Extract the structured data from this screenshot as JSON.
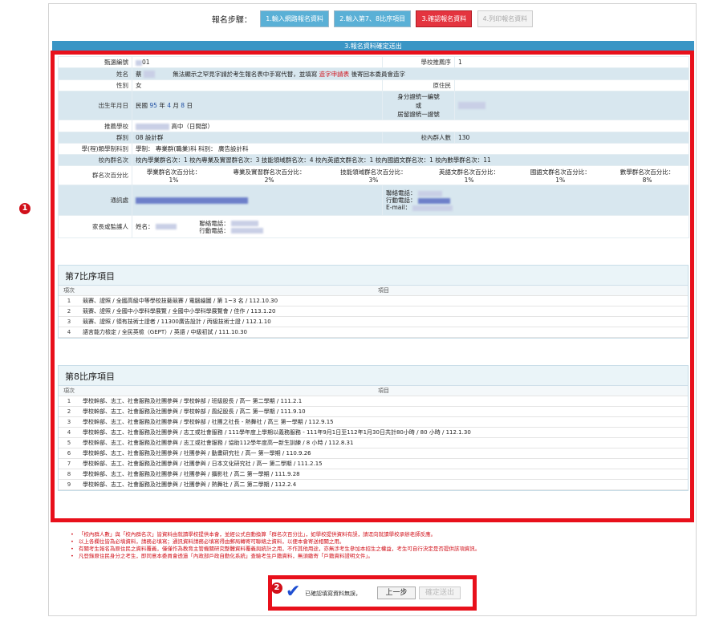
{
  "steps": {
    "label": "報名步驟：",
    "items": [
      {
        "label": "1.輸入網路報名資料",
        "state": "done"
      },
      {
        "label": "2.輸入第7、8比序項目",
        "state": "done"
      },
      {
        "label": "3.確認報名資料",
        "state": "active"
      },
      {
        "label": "4.列印報名資料",
        "state": "todo"
      }
    ]
  },
  "section_title": "3.報名資料確定送出",
  "badges": {
    "one": "1",
    "two": "2"
  },
  "info": {
    "exam_no_label": "甄選編號",
    "exam_no_value": "01",
    "school_order_label": "學校推薦序",
    "school_order_value": "1",
    "name_label": "姓名",
    "name_value": "蔡",
    "name_note_pre": "無法顯示之罕見字請於考生報名表中手寫代替，並填寫",
    "name_note_link": "造字申請表",
    "name_note_post": "後寄回本委員會造字",
    "gender_label": "性別",
    "gender_value": "女",
    "origin_label": "原住民",
    "origin_value": "",
    "birth_label": "出生年月日",
    "birth_pre": "民國",
    "birth_year": "95",
    "birth_year_unit": "年",
    "birth_month": "4",
    "birth_month_unit": "月",
    "birth_day": "8",
    "birth_day_unit": "日",
    "id_label_1": "身分證統一編號",
    "id_label_2": "或",
    "id_label_3": "居留證統一證號",
    "school_label": "推薦學校",
    "school_value": "高中（日間部）",
    "group_label": "群別",
    "group_value": "08 設計群",
    "group_count_label": "校內群人數",
    "group_count_value": "130",
    "dept_label": "學(程)類學制科別",
    "dept_value": "學制：  專業群(職業)科 科別：  廣告設計科",
    "rank_label": "校內群名次",
    "rank_value": "校內學業群名次：1    校內專業及實習群名次：3    技能領域群名次：4    校內英語文群名次：1    校內國語文群名次：1    校內數學群名次：11",
    "pct_label": "群名次百分比",
    "pct_headers": [
      "學業群名次百分比：",
      "專業及實習群名次百分比：",
      "技能領域群名次百分比：",
      "英語文群名次百分比：",
      "國語文群名次百分比：",
      "數學群名次百分比："
    ],
    "pct_values": [
      "1%",
      "2%",
      "3%",
      "1%",
      "1%",
      "8%"
    ],
    "addr_label": "通訊處",
    "contact_phone_label": "聯絡電話：",
    "contact_mobile_label": "行動電話：",
    "contact_email_label": "E-mail：",
    "guardian_label": "家長或監護人",
    "guardian_name_label": "姓名：",
    "guardian_phone_label": "聯絡電話：",
    "guardian_mobile_label": "行動電話："
  },
  "section7": {
    "title": "第7比序項目",
    "col_no": "項次",
    "col_item": "項目",
    "rows": [
      {
        "no": "1",
        "item": "競賽、證照 / 全國高級中等學校技藝競賽 / 電腦繪圖 / 第 1~3 名 / 112.10.30"
      },
      {
        "no": "2",
        "item": "競賽、證照 / 全國中小學科學展覽 / 全國中小學科學展覽會 / 佳作 / 113.1.20"
      },
      {
        "no": "3",
        "item": "競賽、證照 / 領有技術士證者 / 11300廣告設計 / 丙級技術士證 / 112.1.10"
      },
      {
        "no": "4",
        "item": "語言能力檢定 / 全民英檢（GEPT）/ 英語 / 中級初試 / 111.10.30"
      }
    ]
  },
  "section8": {
    "title": "第8比序項目",
    "col_no": "項次",
    "col_item": "項目",
    "rows": [
      {
        "no": "1",
        "item": "學校幹部、志工、社會服務及社團參與 / 學校幹部 / 班級股長 / 高一 第二學期 / 111.2.1"
      },
      {
        "no": "2",
        "item": "學校幹部、志工、社會服務及社團參與 / 學校幹部 / 風紀股長 / 高二 第一學期 / 111.9.10"
      },
      {
        "no": "3",
        "item": "學校幹部、志工、社會服務及社團參與 / 學校幹部 / 社團之社長 - 熱舞社 / 高三 第一學期 / 112.9.15"
      },
      {
        "no": "4",
        "item": "學校幹部、志工、社會服務及社團參與 / 志工或社會服務 / 111學年度上學期以義務服務 - 111年9月1日至112年1月30日共計80小時 / 80 小時 / 112.1.30"
      },
      {
        "no": "5",
        "item": "學校幹部、志工、社會服務及社團參與 / 志工或社會服務 / 協助112學年度高一新生訓練 / 8 小時 / 112.8.31"
      },
      {
        "no": "6",
        "item": "學校幹部、志工、社會服務及社團參與 / 社團參與 / 動畫研究社 / 高一 第一學期 / 110.9.26"
      },
      {
        "no": "7",
        "item": "學校幹部、志工、社會服務及社團參與 / 社團參與 / 日本文化研究社 / 高一 第二學期 / 111.2.15"
      },
      {
        "no": "8",
        "item": "學校幹部、志工、社會服務及社團參與 / 社團參與 / 攝影社 / 高二 第一學期 / 111.9.28"
      },
      {
        "no": "9",
        "item": "學校幹部、志工、社會服務及社團參與 / 社團參與 / 熱舞社 / 高二 第二學期 / 112.2.4"
      }
    ]
  },
  "notes": [
    "「校內群人數」與「校內群名次」皆資料由就讀學校提供本會，並經公式自動換算「群名次百分比」，如學校提供資料有誤，請逕向就讀學校承辦老師反應。",
    "以上各欄位皆為必填資料，請務必填寫；通訊資料請務必填寫得由郵局轉寄可聯絡之資料，以便本會寄送相關之用。",
    "有關考生報名為原住民之資料覆義，僅僅作為教育主管機關研究整體資料覆義與統計之用，不作其他用途，亦無涉考生參加本招生之權益，考生可自行決定是否提供該項資訊。",
    "凡登錄原住民身分之考生，即同意本委員會透過「內政部戶政自動化系統」查驗考生戶籍資料，無須繳寄「戶籍資料證明文件」。"
  ],
  "footer": {
    "confirm_label": "已確認填寫資料無誤，",
    "back_label": "上一步",
    "submit_label": "確定送出"
  },
  "colors": {
    "accent": "#3a95c5",
    "highlight": "#e8101b",
    "stripe": "#d8e7ef"
  }
}
